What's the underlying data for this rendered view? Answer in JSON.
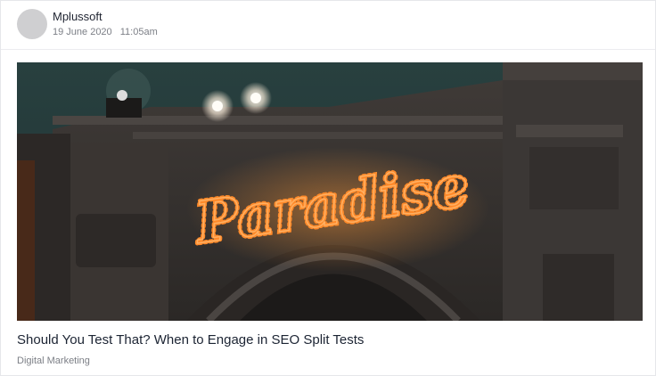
{
  "post": {
    "author": "Mplussoft",
    "date": "19 June 2020",
    "time": "11:05am",
    "title": "Should You Test That? When to Engage in SEO Split Tests",
    "category": "Digital Marketing",
    "image": {
      "sign_text": "Paradise",
      "icon": "building-marquee-photo"
    }
  },
  "colors": {
    "sky": "#23383a",
    "facade": "#3a3634",
    "neon": "#f7872b",
    "light": "#f4f0ea"
  }
}
